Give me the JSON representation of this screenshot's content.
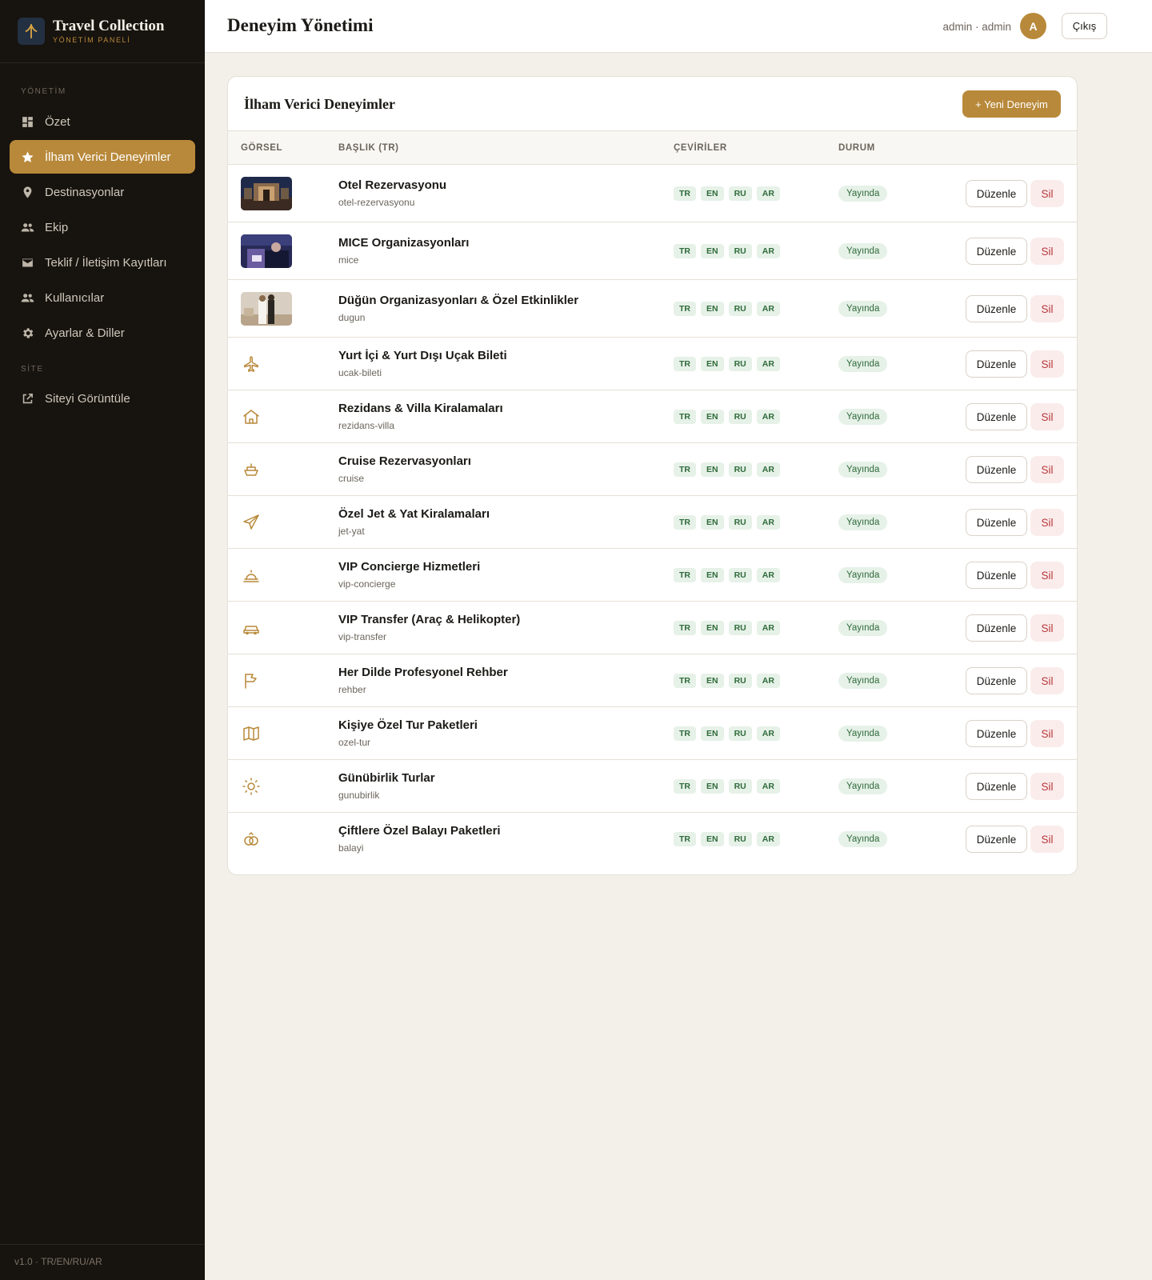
{
  "brand": {
    "title": "Travel Collection",
    "subtitle": "YÖNETİM PANELİ"
  },
  "sidebar": {
    "section_admin": "YÖNETİM",
    "section_site": "SİTE",
    "items": [
      {
        "label": "Özet",
        "icon": "dashboard-icon",
        "active": false
      },
      {
        "label": "İlham Verici Deneyimler",
        "icon": "star-icon",
        "active": true
      },
      {
        "label": "Destinasyonlar",
        "icon": "map-pin-icon",
        "active": false
      },
      {
        "label": "Ekip",
        "icon": "users-icon",
        "active": false
      },
      {
        "label": "Teklif / İletişim Kayıtları",
        "icon": "mail-icon",
        "active": false
      },
      {
        "label": "Kullanıcılar",
        "icon": "users-icon",
        "active": false
      },
      {
        "label": "Ayarlar & Diller",
        "icon": "gear-icon",
        "active": false
      },
      {
        "label": "Siteyi Görüntüle",
        "icon": "external-link-icon",
        "active": false
      }
    ],
    "version": "v1.0 · TR/EN/RU/AR"
  },
  "header": {
    "title": "Deneyim Yönetimi",
    "user": "admin · admin",
    "avatar_initial": "A",
    "logout_label": "Çıkış"
  },
  "card": {
    "title": "İlham Verici Deneyimler",
    "new_button": "+ Yeni Deneyim",
    "columns": {
      "image": "GÖRSEL",
      "title": "BAŞLIK (TR)",
      "translations": "ÇEVİRİLER",
      "status": "DURUM"
    },
    "langs": [
      "TR",
      "EN",
      "RU",
      "AR"
    ],
    "edit_label": "Düzenle",
    "delete_label": "Sil",
    "rows": [
      {
        "title": "Otel Rezervasyonu",
        "slug": "otel-rezervasyonu",
        "status": "Yayında",
        "image": "photo-hotel"
      },
      {
        "title": "MICE Organizasyonları",
        "slug": "mice",
        "status": "Yayında",
        "image": "photo-mice"
      },
      {
        "title": "Düğün Organizasyonları & Özel Etkinlikler",
        "slug": "dugun",
        "status": "Yayında",
        "image": "photo-wedding"
      },
      {
        "title": "Yurt İçi & Yurt Dışı Uçak Bileti",
        "slug": "ucak-bileti",
        "status": "Yayında",
        "icon": "plane-icon"
      },
      {
        "title": "Rezidans & Villa Kiralamaları",
        "slug": "rezidans-villa",
        "status": "Yayında",
        "icon": "house-icon"
      },
      {
        "title": "Cruise Rezervasyonları",
        "slug": "cruise",
        "status": "Yayında",
        "icon": "ship-icon"
      },
      {
        "title": "Özel Jet & Yat Kiralamaları",
        "slug": "jet-yat",
        "status": "Yayında",
        "icon": "send-icon"
      },
      {
        "title": "VIP Concierge Hizmetleri",
        "slug": "vip-concierge",
        "status": "Yayında",
        "icon": "bell-icon"
      },
      {
        "title": "VIP Transfer (Araç & Helikopter)",
        "slug": "vip-transfer",
        "status": "Yayında",
        "icon": "car-icon"
      },
      {
        "title": "Her Dilde Profesyonel Rehber",
        "slug": "rehber",
        "status": "Yayında",
        "icon": "flag-icon"
      },
      {
        "title": "Kişiye Özel Tur Paketleri",
        "slug": "ozel-tur",
        "status": "Yayında",
        "icon": "map-icon"
      },
      {
        "title": "Günübirlik Turlar",
        "slug": "gunubirlik",
        "status": "Yayında",
        "icon": "sun-icon"
      },
      {
        "title": "Çiftlere Özel Balayı Paketleri",
        "slug": "balayi",
        "status": "Yayında",
        "icon": "rings-icon"
      }
    ]
  },
  "colors": {
    "accent": "#b8893a",
    "sidebar": "#17130f",
    "success_bg": "#e6f1e8",
    "success_text": "#2f6b3a",
    "danger_bg": "#fbecec",
    "danger_text": "#b7373a"
  }
}
